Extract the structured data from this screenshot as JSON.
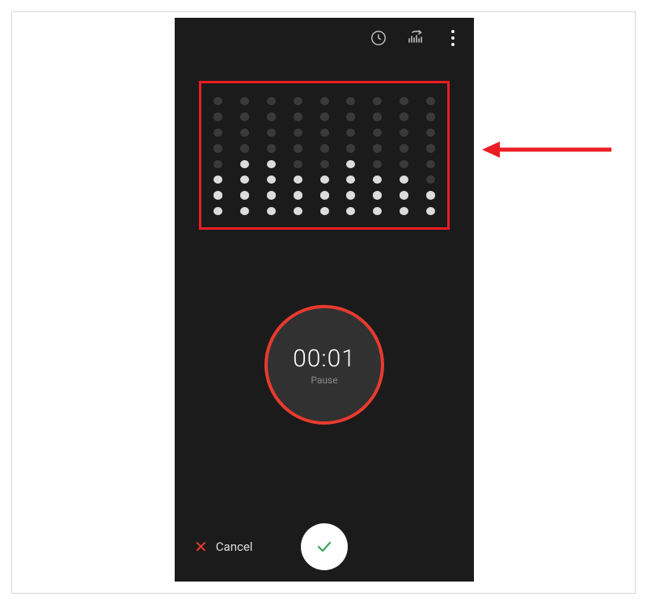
{
  "topbar": {
    "history_icon": "history",
    "waveform_icon": "waveform",
    "more_icon": "more"
  },
  "equalizer": {
    "columns_active_count": [
      3,
      4,
      4,
      3,
      3,
      4,
      3,
      3,
      2
    ],
    "rows": 8
  },
  "recorder": {
    "timer": "00:01",
    "pause_label": "Pause"
  },
  "bottom": {
    "cancel_label": "Cancel"
  },
  "annotation": {
    "highlight": true,
    "arrow": true
  }
}
